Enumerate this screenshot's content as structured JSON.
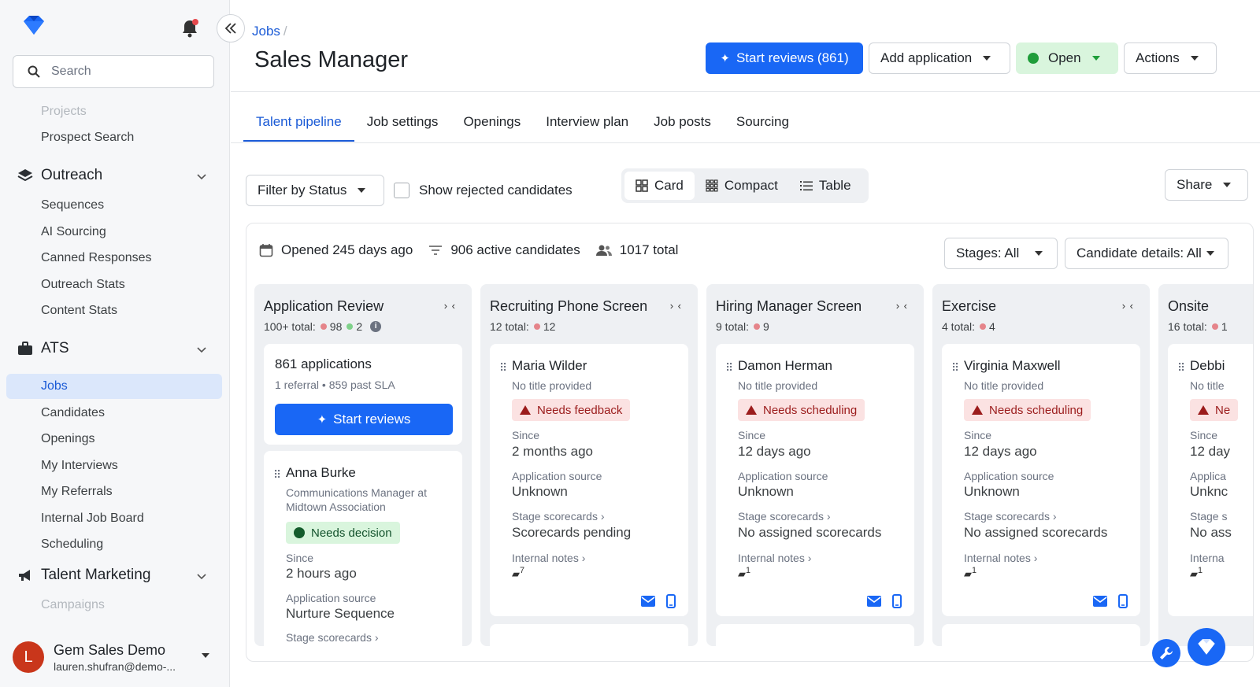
{
  "sidebar": {
    "search_placeholder": "Search",
    "items_top": [
      "Projects",
      "Prospect Search"
    ],
    "outreach": {
      "title": "Outreach",
      "items": [
        "Sequences",
        "AI Sourcing",
        "Canned Responses",
        "Outreach Stats",
        "Content Stats"
      ]
    },
    "ats": {
      "title": "ATS",
      "items": [
        "Jobs",
        "Candidates",
        "Openings",
        "My Interviews",
        "My Referrals",
        "Internal Job Board",
        "Scheduling"
      ]
    },
    "talent_marketing": {
      "title": "Talent Marketing",
      "items": [
        "Campaigns"
      ]
    },
    "user": {
      "initial": "L",
      "name": "Gem Sales Demo",
      "email": "lauren.shufran@demo-..."
    }
  },
  "header": {
    "breadcrumb": "Jobs",
    "breadcrumb_sep": "/",
    "title": "Sales Manager",
    "start_reviews": "Start reviews (861)",
    "add_application": "Add application",
    "status": "Open",
    "actions": "Actions"
  },
  "tabs": [
    "Talent pipeline",
    "Job settings",
    "Openings",
    "Interview plan",
    "Job posts",
    "Sourcing"
  ],
  "toolbar": {
    "filter": "Filter by Status",
    "show_rejected": "Show rejected candidates",
    "views": [
      "Card",
      "Compact",
      "Table"
    ],
    "share": "Share"
  },
  "board": {
    "opened": "Opened 245 days ago",
    "active": "906 active candidates",
    "total": "1017 total",
    "stages": "Stages: All",
    "details": "Candidate details: All",
    "collapse_glyph": "› ‹",
    "columns": [
      {
        "title": "Application Review",
        "total_label": "100+ total:",
        "red": "98",
        "green": "2",
        "summary": {
          "count": "861 applications",
          "meta": "1 referral  •  859 past SLA",
          "button": "Start reviews"
        },
        "card": {
          "name": "Anna Burke",
          "subtitle": "Communications Manager at Midtown Association",
          "badge": "Needs decision",
          "since_label": "Since",
          "since": "2 hours ago",
          "source_label": "Application source",
          "source": "Nurture Sequence",
          "scorecards_label": "Stage scorecards ›"
        }
      },
      {
        "title": "Recruiting Phone Screen",
        "total_label": "12 total:",
        "red": "12",
        "card": {
          "name": "Maria Wilder",
          "subtitle": "No title provided",
          "badge": "Needs feedback",
          "since_label": "Since",
          "since": "2 months ago",
          "source_label": "Application source",
          "source": "Unknown",
          "scorecards_label": "Stage scorecards ›",
          "scorecards": "Scorecards pending",
          "notes_label": "Internal notes ›",
          "notes_count": "7"
        }
      },
      {
        "title": "Hiring Manager Screen",
        "total_label": "9 total:",
        "red": "9",
        "card": {
          "name": "Damon Herman",
          "subtitle": "No title provided",
          "badge": "Needs scheduling",
          "since_label": "Since",
          "since": "12 days ago",
          "source_label": "Application source",
          "source": "Unknown",
          "scorecards_label": "Stage scorecards ›",
          "scorecards": "No assigned scorecards",
          "notes_label": "Internal notes ›",
          "notes_count": "1"
        }
      },
      {
        "title": "Exercise",
        "total_label": "4 total:",
        "red": "4",
        "card": {
          "name": "Virginia Maxwell",
          "subtitle": "No title provided",
          "badge": "Needs scheduling",
          "since_label": "Since",
          "since": "12 days ago",
          "source_label": "Application source",
          "source": "Unknown",
          "scorecards_label": "Stage scorecards ›",
          "scorecards": "No assigned scorecards",
          "notes_label": "Internal notes ›",
          "notes_count": "1"
        }
      },
      {
        "title": "Onsite",
        "total_label": "16 total:",
        "red": "1",
        "card": {
          "name": "Debbi",
          "subtitle": "No title",
          "badge": "Ne",
          "since_label": "Since",
          "since": "12 day",
          "source_label": "Applica",
          "source": "Unknc",
          "scorecards_label": "Stage s",
          "scorecards": "No ass",
          "notes_label": "Interna",
          "notes_count": "1"
        }
      }
    ]
  },
  "colors": {
    "primary": "#1967f5",
    "active_nav_bg": "#dbe7fb",
    "open_bg": "#d9f5dd",
    "badge_red_bg": "#fbe2e2",
    "badge_green_bg": "#d9f5dd"
  },
  "icons": [
    "gem-logo-icon",
    "bell-icon",
    "double-chevron-left-icon",
    "search-icon",
    "layers-icon",
    "briefcase-icon",
    "megaphone-icon",
    "chevron-down-icon",
    "sparkle-icon",
    "calendar-icon",
    "filter-icon",
    "people-icon",
    "info-icon",
    "grip-icon",
    "warning-icon",
    "note-icon",
    "mail-icon",
    "phone-icon",
    "wrench-icon"
  ]
}
